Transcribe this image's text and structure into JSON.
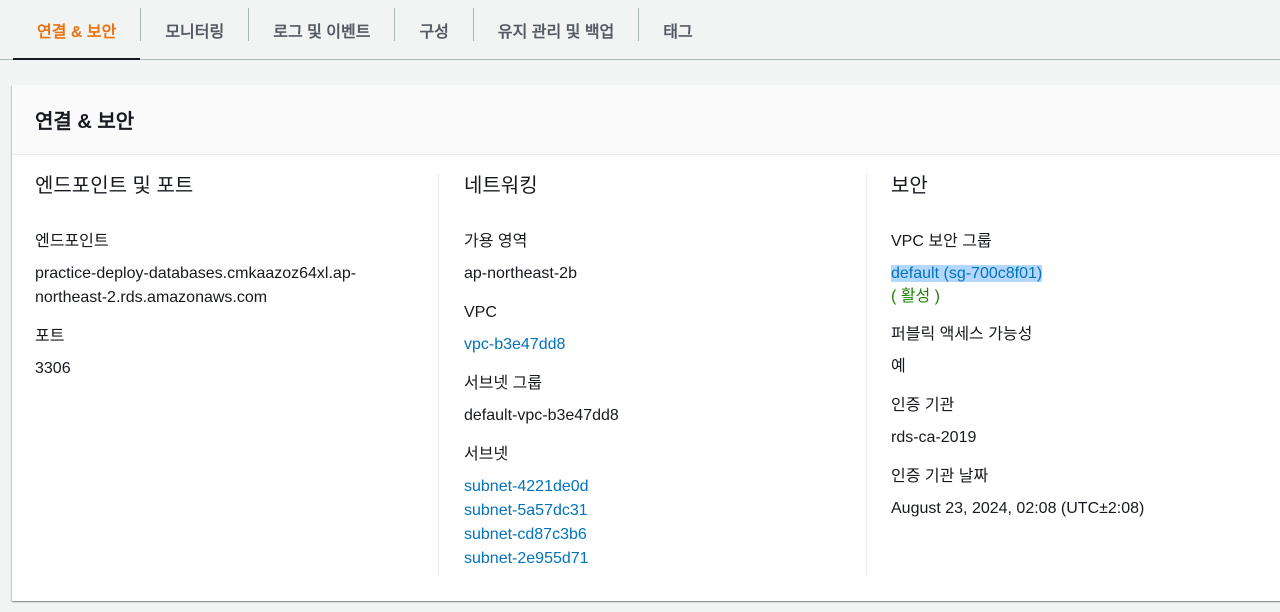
{
  "tabs": [
    {
      "label": "연결 & 보안",
      "active": true
    },
    {
      "label": "모니터링"
    },
    {
      "label": "로그 및 이벤트"
    },
    {
      "label": "구성"
    },
    {
      "label": "유지 관리 및 백업"
    },
    {
      "label": "태그"
    }
  ],
  "panel": {
    "title": "연결 & 보안",
    "endpoint_section": {
      "title": "엔드포인트 및 포트",
      "endpoint_label": "엔드포인트",
      "endpoint_value_line1": "practice-deploy-databases.cmkaazoz64xl.ap-",
      "endpoint_value_line2": "northeast-2.rds.amazonaws.com",
      "port_label": "포트",
      "port_value": "3306"
    },
    "networking_section": {
      "title": "네트워킹",
      "az_label": "가용 영역",
      "az_value": "ap-northeast-2b",
      "vpc_label": "VPC",
      "vpc_value": "vpc-b3e47dd8",
      "subnet_group_label": "서브넷 그룹",
      "subnet_group_value": "default-vpc-b3e47dd8",
      "subnets_label": "서브넷",
      "subnets": [
        "subnet-4221de0d",
        "subnet-5a57dc31",
        "subnet-cd87c3b6",
        "subnet-2e955d71"
      ]
    },
    "security_section": {
      "title": "보안",
      "sg_label": "VPC 보안 그룹",
      "sg_value": "default (sg-700c8f01)",
      "sg_status": "( 활성 )",
      "public_label": "퍼블릭 액세스 가능성",
      "public_value": "예",
      "ca_label": "인증 기관",
      "ca_value": "rds-ca-2019",
      "ca_date_label": "인증 기관 날짜",
      "ca_date_value": "August 23, 2024, 02:08 (UTC±2:08)"
    }
  },
  "colors": {
    "accent": "#ec7211",
    "link": "#0073bb",
    "success": "#1d8102"
  }
}
